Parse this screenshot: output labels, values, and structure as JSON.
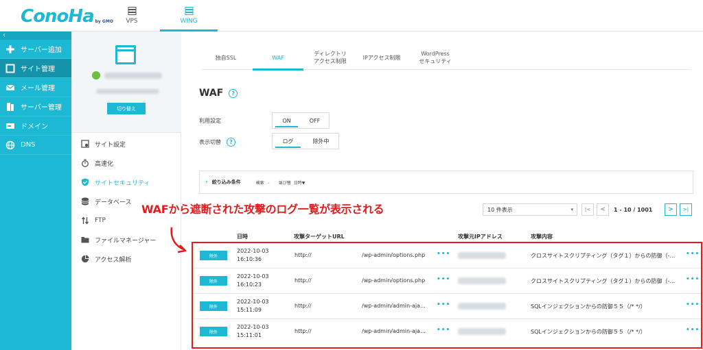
{
  "logo": {
    "brand": "ConoHa",
    "sub": "by GMO"
  },
  "top_tabs": [
    {
      "label": "VPS",
      "icon": "server-icon"
    },
    {
      "label": "WING",
      "icon": "wing-server-icon",
      "active": true
    }
  ],
  "sidebar": {
    "collapse": "‹",
    "items": [
      {
        "label": "サーバー追加",
        "icon": "plus-icon"
      },
      {
        "label": "サイト管理",
        "icon": "window-icon",
        "active": true
      },
      {
        "label": "メール管理",
        "icon": "mail-icon"
      },
      {
        "label": "サーバー管理",
        "icon": "server-icon"
      },
      {
        "label": "ドメイン",
        "icon": "domain-icon"
      },
      {
        "label": "DNS",
        "icon": "globe-icon"
      }
    ]
  },
  "site_card": {
    "switch_label": "切り替え"
  },
  "site_menu": [
    {
      "label": "サイト設定",
      "icon": "settings-icon"
    },
    {
      "label": "高速化",
      "icon": "stopwatch-icon"
    },
    {
      "label": "サイトセキュリティ",
      "icon": "shield-icon",
      "active": true
    },
    {
      "label": "データベース",
      "icon": "database-icon"
    },
    {
      "label": "FTP",
      "icon": "transfer-icon"
    },
    {
      "label": "ファイルマネージャー",
      "icon": "folder-icon"
    },
    {
      "label": "アクセス解析",
      "icon": "pie-chart-icon"
    }
  ],
  "tabs": [
    {
      "label": "独自SSL"
    },
    {
      "label": "WAF",
      "active": true
    },
    {
      "label": "ディレクトリ\nアクセス制限"
    },
    {
      "label": "IPアクセス制限"
    },
    {
      "label": "WordPress\nセキュリティ"
    }
  ],
  "waf": {
    "title": "WAF",
    "usage_label": "利用設定",
    "usage_on": "ON",
    "usage_off": "OFF",
    "view_label": "表示切替",
    "view_log": "ログ",
    "view_excluded": "除外中"
  },
  "filter": {
    "label": "絞り込み条件",
    "search": "検索",
    "sort_label": "並び替",
    "sort_value": "日時▼"
  },
  "annotation": "WAFから遮断された攻撃のログ一覧が表示される",
  "pagination": {
    "per_page": "10 件表示",
    "first": "|<",
    "prev": "<",
    "range": "1 - 10 / 1001",
    "next": ">",
    "last": ">|"
  },
  "table": {
    "headers": {
      "datetime": "日時",
      "target_url": "攻撃ターゲットURL",
      "source_ip": "攻撃元IPアドレス",
      "content": "攻撃内容"
    },
    "rows": [
      {
        "button": "除外",
        "date": "2022-10-03",
        "time": "16:10:36",
        "scheme": "http://",
        "path": "/wp-admin/options.php",
        "content": "クロスサイトスクリプティング（タグ１）からの防御（-…"
      },
      {
        "button": "除外",
        "date": "2022-10-03",
        "time": "16:10:23",
        "scheme": "http://",
        "path": "/wp-admin/options.php",
        "content": "クロスサイトスクリプティング（タグ１）からの防御（-…"
      },
      {
        "button": "除外",
        "date": "2022-10-03",
        "time": "15:11:09",
        "scheme": "http://",
        "path": "/wp-admin/admin-aja…",
        "content": "SQLインジェクションからの防御５５（/* */）"
      },
      {
        "button": "除外",
        "date": "2022-10-03",
        "time": "15:11:01",
        "scheme": "http://",
        "path": "/wp-admin/admin-aja…",
        "content": "SQLインジェクションからの防御５５（/* */）"
      }
    ],
    "more": "•••"
  },
  "colors": {
    "accent": "#1cb8d4",
    "annotation": "#e21c1c"
  }
}
